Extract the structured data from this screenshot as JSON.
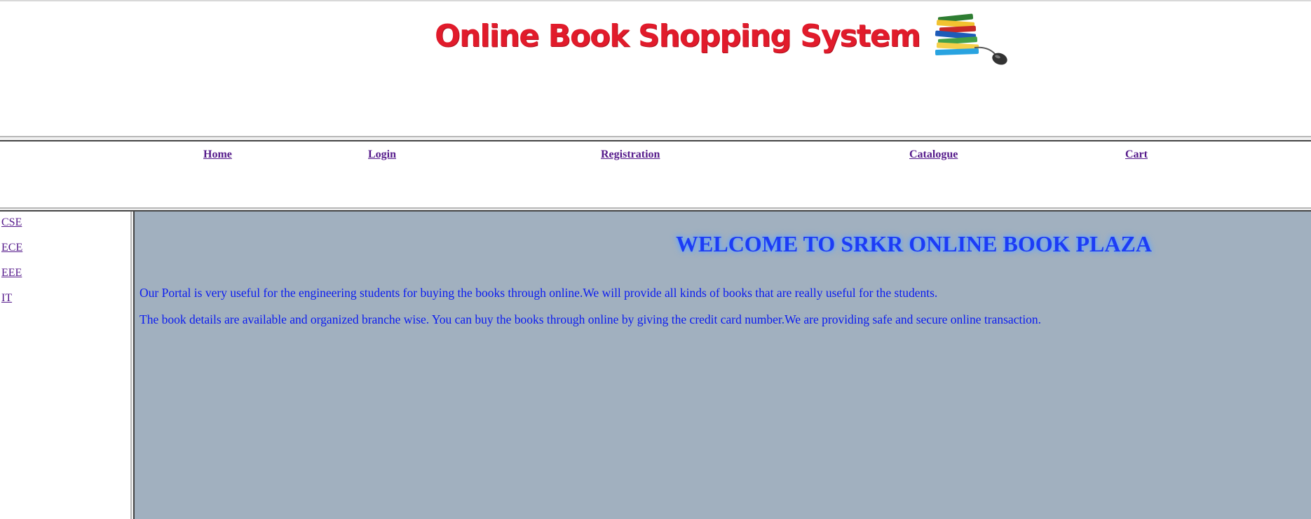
{
  "banner": {
    "title": "Online Book Shopping System",
    "logo_icon": "books-mouse-icon",
    "title_color": "#e11b2b"
  },
  "nav": {
    "items": [
      {
        "label": "Home"
      },
      {
        "label": "Login"
      },
      {
        "label": "Registration"
      },
      {
        "label": "Catalogue"
      },
      {
        "label": "Cart"
      }
    ]
  },
  "sidebar": {
    "items": [
      {
        "label": "CSE"
      },
      {
        "label": "ECE"
      },
      {
        "label": "EEE"
      },
      {
        "label": "IT"
      }
    ]
  },
  "main": {
    "heading": "WELCOME TO SRKR ONLINE BOOK PLAZA",
    "paragraphs": [
      "Our Portal is very useful for the engineering students for buying the books through online.We will provide all kinds of books that are really useful for the students.",
      "The book details are available and organized branche wise. You can buy the books through online by giving the credit card number.We are providing safe and secure online transaction."
    ],
    "background_color": "#a1b0bf",
    "text_color": "#0b1cf0"
  },
  "colors": {
    "link_visited": "#551a8b"
  }
}
